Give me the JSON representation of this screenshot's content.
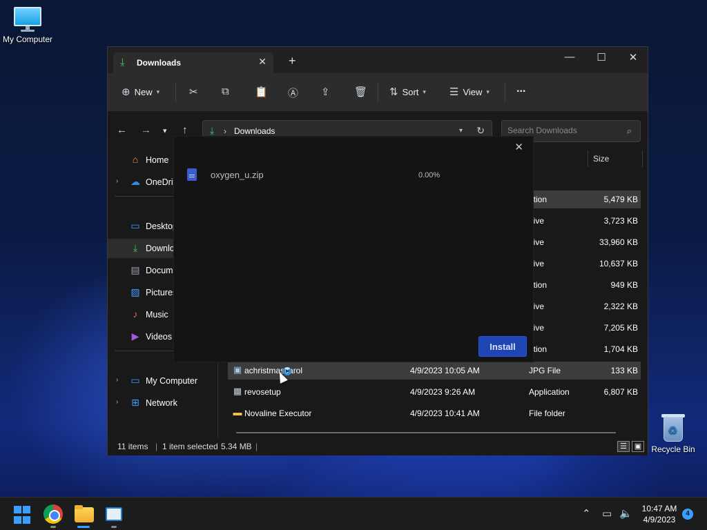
{
  "desktop": {
    "my_computer_label": "My Computer",
    "recycle_bin_label": "Recycle Bin"
  },
  "explorer": {
    "tab_title": "Downloads",
    "toolbar": {
      "new_label": "New",
      "sort_label": "Sort",
      "view_label": "View",
      "more_label": "..."
    },
    "address": {
      "path": "Downloads"
    },
    "search": {
      "placeholder": "Search Downloads"
    },
    "sidebar": {
      "items": [
        {
          "label": "Home"
        },
        {
          "label": "OneDrive"
        },
        {
          "label": "Desktop"
        },
        {
          "label": "Downloads"
        },
        {
          "label": "Documents"
        },
        {
          "label": "Pictures"
        },
        {
          "label": "Music"
        },
        {
          "label": "Videos"
        },
        {
          "label": "My Computer"
        },
        {
          "label": "Network"
        }
      ]
    },
    "columns": {
      "size": "Size"
    },
    "files": [
      {
        "type": "ation",
        "size": "5,479 KB"
      },
      {
        "type": "hive",
        "size": "3,723 KB"
      },
      {
        "type": "hive",
        "size": "33,960 KB"
      },
      {
        "type": "hive",
        "size": "10,637 KB"
      },
      {
        "type": "ation",
        "size": "949 KB"
      },
      {
        "type": "hive",
        "size": "2,322 KB"
      },
      {
        "type": "hive",
        "size": "7,205 KB"
      },
      {
        "type": "ation",
        "size": "1,704 KB"
      },
      {
        "name": "achristmascarol",
        "date": "4/9/2023 10:05 AM",
        "type": "JPG File",
        "size": "133 KB"
      },
      {
        "name": "revosetup",
        "date": "4/9/2023 9:26 AM",
        "type": "Application",
        "size": "6,807 KB"
      },
      {
        "name": "Novaline Executor",
        "date": "4/9/2023 10:41 AM",
        "type": "File folder",
        "size": ""
      }
    ],
    "status": {
      "items": "11 items",
      "selected": "1 item selected",
      "selected_size": "5.34 MB"
    }
  },
  "installer": {
    "file_name": "oxygen_u.zip",
    "progress": "0.00%",
    "install_label": "Install"
  },
  "taskbar": {
    "time": "10:47 AM",
    "date": "4/9/2023",
    "notification_count": "4"
  }
}
